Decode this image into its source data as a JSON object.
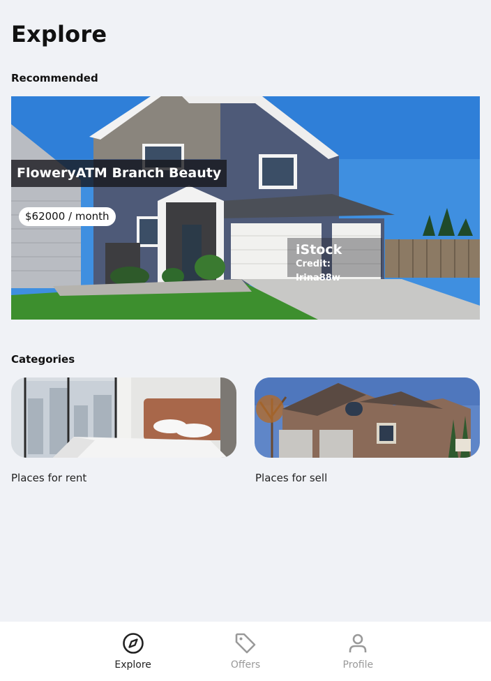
{
  "header": {
    "title": "Explore"
  },
  "recommended": {
    "section_title": "Recommended",
    "name": "FloweryATM Branch Beauty",
    "price": "$62000 / month",
    "watermark": {
      "brand": "iStock",
      "credit": "Credit: Irina88w"
    }
  },
  "categories": {
    "section_title": "Categories",
    "items": [
      {
        "label": "Places for rent"
      },
      {
        "label": "Places for sell"
      }
    ]
  },
  "nav": {
    "items": [
      {
        "label": "Explore",
        "icon": "compass-icon",
        "active": true
      },
      {
        "label": "Offers",
        "icon": "tag-icon",
        "active": false
      },
      {
        "label": "Profile",
        "icon": "user-icon",
        "active": false
      }
    ]
  },
  "colors": {
    "background": "#f0f2f6",
    "nav_background": "#ffffff",
    "active": "#222222",
    "inactive": "#999999"
  }
}
